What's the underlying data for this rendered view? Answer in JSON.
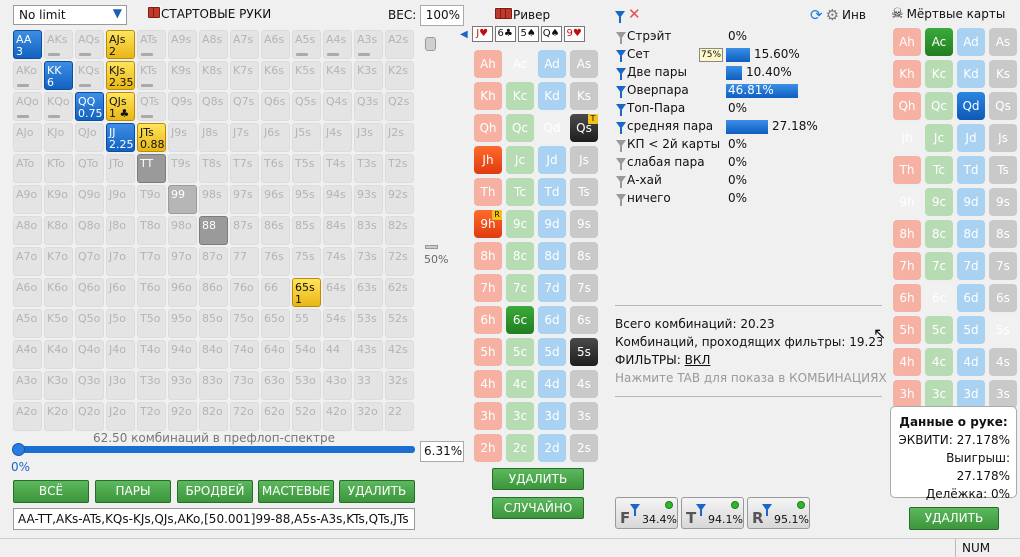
{
  "limit_select": {
    "value": "No limit"
  },
  "range_panel": {
    "title": "СТАРТОВЫЕ РУКИ",
    "weight_label": "ВЕС:",
    "weight_value": "100%",
    "vertical_slider_label": "50%",
    "combos_text": "62.50 комбинаций в префлоп-спектре",
    "slider_left_label": "0%",
    "percent_value": "6.31%",
    "range_text": "AA-TT,AKs-ATs,KQs-KJs,QJs,AKo,[50.001]99-88,A5s-A3s,KTs,QTs,JTs"
  },
  "grid": [
    [
      [
        "AA",
        "3",
        "blue"
      ],
      [
        "AKs",
        "",
        "mark"
      ],
      [
        "AQs",
        "",
        "mark"
      ],
      [
        "AJs",
        "2 ♠◆",
        "yellow"
      ],
      [
        "ATs",
        "",
        "mark"
      ],
      [
        "A9s",
        "",
        ""
      ],
      [
        "A8s",
        "",
        ""
      ],
      [
        "A7s",
        "",
        ""
      ],
      [
        "A6s",
        "",
        ""
      ],
      [
        "A5s",
        "",
        "mark"
      ],
      [
        "A4s",
        "",
        "mark"
      ],
      [
        "A3s",
        "",
        "mark"
      ],
      [
        "A2s",
        "",
        ""
      ]
    ],
    [
      [
        "AKo",
        "",
        "mark"
      ],
      [
        "KK",
        "6",
        "blue"
      ],
      [
        "KQs",
        "",
        "mark"
      ],
      [
        "KJs",
        "2.35",
        "yellow"
      ],
      [
        "KTs",
        "",
        "mark"
      ],
      [
        "K9s",
        "",
        ""
      ],
      [
        "K8s",
        "",
        ""
      ],
      [
        "K7s",
        "",
        ""
      ],
      [
        "K6s",
        "",
        ""
      ],
      [
        "K5s",
        "",
        ""
      ],
      [
        "K4s",
        "",
        ""
      ],
      [
        "K3s",
        "",
        ""
      ],
      [
        "K2s",
        "",
        ""
      ]
    ],
    [
      [
        "AQo",
        "",
        "mark"
      ],
      [
        "KQo",
        "",
        "mark"
      ],
      [
        "QQ",
        "0.75",
        "blue"
      ],
      [
        "QJs",
        "1 ♣",
        "yellow"
      ],
      [
        "QTs",
        "",
        "mark"
      ],
      [
        "Q9s",
        "",
        ""
      ],
      [
        "Q8s",
        "",
        ""
      ],
      [
        "Q7s",
        "",
        ""
      ],
      [
        "Q6s",
        "",
        ""
      ],
      [
        "Q5s",
        "",
        ""
      ],
      [
        "Q4s",
        "",
        ""
      ],
      [
        "Q3s",
        "",
        ""
      ],
      [
        "Q2s",
        "",
        ""
      ]
    ],
    [
      [
        "AJo",
        "",
        ""
      ],
      [
        "KJo",
        "",
        ""
      ],
      [
        "QJo",
        "",
        ""
      ],
      [
        "JJ",
        "2.25",
        "blue"
      ],
      [
        "JTs",
        "0.88",
        "yellow"
      ],
      [
        "J9s",
        "",
        ""
      ],
      [
        "J8s",
        "",
        ""
      ],
      [
        "J7s",
        "",
        ""
      ],
      [
        "J6s",
        "",
        ""
      ],
      [
        "J5s",
        "",
        ""
      ],
      [
        "J4s",
        "",
        ""
      ],
      [
        "J3s",
        "",
        ""
      ],
      [
        "J2s",
        "",
        ""
      ]
    ],
    [
      [
        "ATo",
        "",
        ""
      ],
      [
        "KTo",
        "",
        ""
      ],
      [
        "QTo",
        "",
        ""
      ],
      [
        "JTo",
        "",
        ""
      ],
      [
        "TT",
        "",
        "gray"
      ],
      [
        "T9s",
        "",
        ""
      ],
      [
        "T8s",
        "",
        ""
      ],
      [
        "T7s",
        "",
        ""
      ],
      [
        "T6s",
        "",
        ""
      ],
      [
        "T5s",
        "",
        ""
      ],
      [
        "T4s",
        "",
        ""
      ],
      [
        "T3s",
        "",
        ""
      ],
      [
        "T2s",
        "",
        ""
      ]
    ],
    [
      [
        "A9o",
        "",
        ""
      ],
      [
        "K9o",
        "",
        ""
      ],
      [
        "Q9o",
        "",
        ""
      ],
      [
        "J9o",
        "",
        ""
      ],
      [
        "T9o",
        "",
        ""
      ],
      [
        "99",
        "",
        "lgray"
      ],
      [
        "98s",
        "",
        ""
      ],
      [
        "97s",
        "",
        ""
      ],
      [
        "96s",
        "",
        ""
      ],
      [
        "95s",
        "",
        ""
      ],
      [
        "94s",
        "",
        ""
      ],
      [
        "93s",
        "",
        ""
      ],
      [
        "92s",
        "",
        ""
      ]
    ],
    [
      [
        "A8o",
        "",
        ""
      ],
      [
        "K8o",
        "",
        ""
      ],
      [
        "Q8o",
        "",
        ""
      ],
      [
        "J8o",
        "",
        ""
      ],
      [
        "T8o",
        "",
        ""
      ],
      [
        "98o",
        "",
        ""
      ],
      [
        "88",
        "",
        "gray"
      ],
      [
        "87s",
        "",
        ""
      ],
      [
        "86s",
        "",
        ""
      ],
      [
        "85s",
        "",
        ""
      ],
      [
        "84s",
        "",
        ""
      ],
      [
        "83s",
        "",
        ""
      ],
      [
        "82s",
        "",
        ""
      ]
    ],
    [
      [
        "A7o",
        "",
        ""
      ],
      [
        "K7o",
        "",
        ""
      ],
      [
        "Q7o",
        "",
        ""
      ],
      [
        "J7o",
        "",
        ""
      ],
      [
        "T7o",
        "",
        ""
      ],
      [
        "97o",
        "",
        ""
      ],
      [
        "87o",
        "",
        ""
      ],
      [
        "77",
        "",
        ""
      ],
      [
        "76s",
        "",
        ""
      ],
      [
        "75s",
        "",
        ""
      ],
      [
        "74s",
        "",
        ""
      ],
      [
        "73s",
        "",
        ""
      ],
      [
        "72s",
        "",
        ""
      ]
    ],
    [
      [
        "A6o",
        "",
        ""
      ],
      [
        "K6o",
        "",
        ""
      ],
      [
        "Q6o",
        "",
        ""
      ],
      [
        "J6o",
        "",
        ""
      ],
      [
        "T6o",
        "",
        ""
      ],
      [
        "96o",
        "",
        ""
      ],
      [
        "86o",
        "",
        ""
      ],
      [
        "76o",
        "",
        ""
      ],
      [
        "66",
        "",
        ""
      ],
      [
        "65s",
        "1",
        "yellow"
      ],
      [
        "64s",
        "",
        ""
      ],
      [
        "63s",
        "",
        ""
      ],
      [
        "62s",
        "",
        ""
      ]
    ],
    [
      [
        "A5o",
        "",
        ""
      ],
      [
        "K5o",
        "",
        ""
      ],
      [
        "Q5o",
        "",
        ""
      ],
      [
        "J5o",
        "",
        ""
      ],
      [
        "T5o",
        "",
        ""
      ],
      [
        "95o",
        "",
        ""
      ],
      [
        "85o",
        "",
        ""
      ],
      [
        "75o",
        "",
        ""
      ],
      [
        "65o",
        "",
        ""
      ],
      [
        "55",
        "",
        ""
      ],
      [
        "54s",
        "",
        ""
      ],
      [
        "53s",
        "",
        ""
      ],
      [
        "52s",
        "",
        ""
      ]
    ],
    [
      [
        "A4o",
        "",
        ""
      ],
      [
        "K4o",
        "",
        ""
      ],
      [
        "Q4o",
        "",
        ""
      ],
      [
        "J4o",
        "",
        ""
      ],
      [
        "T4o",
        "",
        ""
      ],
      [
        "94o",
        "",
        ""
      ],
      [
        "84o",
        "",
        ""
      ],
      [
        "74o",
        "",
        ""
      ],
      [
        "64o",
        "",
        ""
      ],
      [
        "54o",
        "",
        ""
      ],
      [
        "44",
        "",
        ""
      ],
      [
        "43s",
        "",
        ""
      ],
      [
        "42s",
        "",
        ""
      ]
    ],
    [
      [
        "A3o",
        "",
        ""
      ],
      [
        "K3o",
        "",
        ""
      ],
      [
        "Q3o",
        "",
        ""
      ],
      [
        "J3o",
        "",
        ""
      ],
      [
        "T3o",
        "",
        ""
      ],
      [
        "93o",
        "",
        ""
      ],
      [
        "83o",
        "",
        ""
      ],
      [
        "73o",
        "",
        ""
      ],
      [
        "63o",
        "",
        ""
      ],
      [
        "53o",
        "",
        ""
      ],
      [
        "43o",
        "",
        ""
      ],
      [
        "33",
        "",
        ""
      ],
      [
        "32s",
        "",
        ""
      ]
    ],
    [
      [
        "A2o",
        "",
        ""
      ],
      [
        "K2o",
        "",
        ""
      ],
      [
        "Q2o",
        "",
        ""
      ],
      [
        "J2o",
        "",
        ""
      ],
      [
        "T2o",
        "",
        ""
      ],
      [
        "92o",
        "",
        ""
      ],
      [
        "82o",
        "",
        ""
      ],
      [
        "72o",
        "",
        ""
      ],
      [
        "62o",
        "",
        ""
      ],
      [
        "52o",
        "",
        ""
      ],
      [
        "42o",
        "",
        ""
      ],
      [
        "32o",
        "",
        ""
      ],
      [
        "22",
        "",
        ""
      ]
    ]
  ],
  "range_buttons": {
    "all": "ВСЁ",
    "pairs": "ПАРЫ",
    "broadways": "БРОДВЕЙ",
    "suited": "МАСТЕВЫЕ",
    "delete": "УДАЛИТЬ"
  },
  "board": {
    "title": "Ривер",
    "cards": [
      [
        "J",
        "♥",
        "red"
      ],
      [
        "6",
        "♣",
        ""
      ],
      [
        "5",
        "♠",
        ""
      ],
      [
        "Q",
        "♠",
        ""
      ],
      [
        "9",
        "♥",
        "red"
      ]
    ]
  },
  "board_deck": [
    [
      [
        "Ah",
        "h",
        ""
      ],
      [
        "Ac",
        "c",
        "blank"
      ],
      [
        "Ad",
        "d",
        ""
      ],
      [
        "As",
        "s",
        ""
      ]
    ],
    [
      [
        "Kh",
        "h",
        ""
      ],
      [
        "Kc",
        "c",
        ""
      ],
      [
        "Kd",
        "d",
        ""
      ],
      [
        "Ks",
        "s",
        ""
      ]
    ],
    [
      [
        "Qh",
        "h",
        ""
      ],
      [
        "Qc",
        "c",
        ""
      ],
      [
        "Qd",
        "d",
        "blank"
      ],
      [
        "Qs",
        "s",
        "sel",
        "T"
      ]
    ],
    [
      [
        "Jh",
        "h",
        "sel"
      ],
      [
        "Jc",
        "c",
        ""
      ],
      [
        "Jd",
        "d",
        ""
      ],
      [
        "Js",
        "s",
        ""
      ]
    ],
    [
      [
        "Th",
        "h",
        ""
      ],
      [
        "Tc",
        "c",
        ""
      ],
      [
        "Td",
        "d",
        ""
      ],
      [
        "Ts",
        "s",
        ""
      ]
    ],
    [
      [
        "9h",
        "h",
        "sel",
        "R"
      ],
      [
        "9c",
        "c",
        ""
      ],
      [
        "9d",
        "d",
        ""
      ],
      [
        "9s",
        "s",
        ""
      ]
    ],
    [
      [
        "8h",
        "h",
        ""
      ],
      [
        "8c",
        "c",
        ""
      ],
      [
        "8d",
        "d",
        ""
      ],
      [
        "8s",
        "s",
        ""
      ]
    ],
    [
      [
        "7h",
        "h",
        ""
      ],
      [
        "7c",
        "c",
        ""
      ],
      [
        "7d",
        "d",
        ""
      ],
      [
        "7s",
        "s",
        ""
      ]
    ],
    [
      [
        "6h",
        "h",
        ""
      ],
      [
        "6c",
        "c",
        "sel"
      ],
      [
        "6d",
        "d",
        ""
      ],
      [
        "6s",
        "s",
        ""
      ]
    ],
    [
      [
        "5h",
        "h",
        ""
      ],
      [
        "5c",
        "c",
        ""
      ],
      [
        "5d",
        "d",
        ""
      ],
      [
        "5s",
        "s",
        "sel"
      ]
    ],
    [
      [
        "4h",
        "h",
        ""
      ],
      [
        "4c",
        "c",
        ""
      ],
      [
        "4d",
        "d",
        ""
      ],
      [
        "4s",
        "s",
        ""
      ]
    ],
    [
      [
        "3h",
        "h",
        ""
      ],
      [
        "3c",
        "c",
        ""
      ],
      [
        "3d",
        "d",
        ""
      ],
      [
        "3s",
        "s",
        ""
      ]
    ],
    [
      [
        "2h",
        "h",
        ""
      ],
      [
        "2c",
        "c",
        ""
      ],
      [
        "2d",
        "d",
        ""
      ],
      [
        "2s",
        "s",
        ""
      ]
    ]
  ],
  "board_buttons": {
    "delete": "УДАЛИТЬ",
    "random": "СЛУЧАЙНО"
  },
  "stats": [
    {
      "name": "Стрэйт",
      "pct": "0%",
      "value": 0,
      "active": false
    },
    {
      "name": "Сет",
      "pct": "15.60%",
      "value": 15.6,
      "active": true,
      "badge": "75%"
    },
    {
      "name": "Две пары",
      "pct": "10.40%",
      "value": 10.4,
      "active": true
    },
    {
      "name": "Оверпара",
      "pct": "46.81%",
      "value": 46.81,
      "active": true
    },
    {
      "name": "Топ-Пара",
      "pct": "0%",
      "value": 0,
      "active": true
    },
    {
      "name": "средняя пара",
      "pct": "27.18%",
      "value": 27.18,
      "active": true
    },
    {
      "name": "КП < 2й карты",
      "pct": "0%",
      "value": 0,
      "active": false
    },
    {
      "name": "слабая пара",
      "pct": "0%",
      "value": 0,
      "active": false
    },
    {
      "name": "А-хай",
      "pct": "0%",
      "value": 0,
      "active": false
    },
    {
      "name": "ничего",
      "pct": "0%",
      "value": 0,
      "active": false
    }
  ],
  "info": {
    "total_combos": "Всего комбинаций: 20.23",
    "filtered_combos": "Комбинаций, проходящих фильтры: 19.23",
    "filters_label": "ФИЛЬТРЫ:",
    "filters_value": "ВКЛ",
    "hint": "Нажмите TAB для показа в КОМБИНАЦИЯХ"
  },
  "filter_buttons": [
    {
      "letter": "F",
      "value": "34.4%"
    },
    {
      "letter": "T",
      "value": "94.1%"
    },
    {
      "letter": "R",
      "value": "95.1%"
    }
  ],
  "top_right": {
    "inv_label": "Инв",
    "dead_cards_title": "Мёртвые карты"
  },
  "dead_deck": [
    [
      [
        "Ah",
        "h",
        ""
      ],
      [
        "Ac",
        "c",
        "sel"
      ],
      [
        "Ad",
        "d",
        ""
      ],
      [
        "As",
        "s",
        ""
      ]
    ],
    [
      [
        "Kh",
        "h",
        ""
      ],
      [
        "Kc",
        "c",
        ""
      ],
      [
        "Kd",
        "d",
        ""
      ],
      [
        "Ks",
        "s",
        ""
      ]
    ],
    [
      [
        "Qh",
        "h",
        ""
      ],
      [
        "Qc",
        "c",
        ""
      ],
      [
        "Qd",
        "d",
        "sel"
      ],
      [
        "Qs",
        "s",
        ""
      ]
    ],
    [
      [
        "Jh",
        "h",
        "blank"
      ],
      [
        "Jc",
        "c",
        ""
      ],
      [
        "Jd",
        "d",
        ""
      ],
      [
        "Js",
        "s",
        ""
      ]
    ],
    [
      [
        "Th",
        "h",
        ""
      ],
      [
        "Tc",
        "c",
        ""
      ],
      [
        "Td",
        "d",
        ""
      ],
      [
        "Ts",
        "s",
        ""
      ]
    ],
    [
      [
        "9h",
        "h",
        "blank"
      ],
      [
        "9c",
        "c",
        ""
      ],
      [
        "9d",
        "d",
        ""
      ],
      [
        "9s",
        "s",
        ""
      ]
    ],
    [
      [
        "8h",
        "h",
        ""
      ],
      [
        "8c",
        "c",
        ""
      ],
      [
        "8d",
        "d",
        ""
      ],
      [
        "8s",
        "s",
        ""
      ]
    ],
    [
      [
        "7h",
        "h",
        ""
      ],
      [
        "7c",
        "c",
        ""
      ],
      [
        "7d",
        "d",
        ""
      ],
      [
        "7s",
        "s",
        ""
      ]
    ],
    [
      [
        "6h",
        "h",
        ""
      ],
      [
        "6c",
        "c",
        "blank"
      ],
      [
        "6d",
        "d",
        ""
      ],
      [
        "6s",
        "s",
        ""
      ]
    ],
    [
      [
        "5h",
        "h",
        ""
      ],
      [
        "5c",
        "c",
        ""
      ],
      [
        "5d",
        "d",
        ""
      ],
      [
        "5s",
        "s",
        "blank"
      ]
    ],
    [
      [
        "4h",
        "h",
        ""
      ],
      [
        "4c",
        "c",
        ""
      ],
      [
        "4d",
        "d",
        ""
      ],
      [
        "4s",
        "s",
        ""
      ]
    ],
    [
      [
        "3h",
        "h",
        ""
      ],
      [
        "3c",
        "c",
        ""
      ],
      [
        "3d",
        "d",
        ""
      ],
      [
        "3s",
        "s",
        ""
      ]
    ],
    [
      [
        "2h",
        "h",
        ""
      ],
      [
        "2c",
        "c",
        ""
      ],
      [
        "2d",
        "d",
        ""
      ],
      [
        "2s",
        "s",
        ""
      ]
    ]
  ],
  "hand_data": {
    "title": "Данные о руке:",
    "equity": "ЭКВИТИ: 27.178%",
    "win": "Выигрыш: 27.178%",
    "split": "Делёжка: 0%"
  },
  "dead_buttons": {
    "delete": "УДАЛИТЬ"
  },
  "statusbar": {
    "num": "NUM"
  },
  "colors": {
    "accent": "#1a66c8",
    "button_green": "#3c963c",
    "hearts": "#f6b1a3",
    "clubs": "#b7dcb4",
    "diamonds": "#a9d1f2",
    "spades": "#c9c9c9"
  }
}
